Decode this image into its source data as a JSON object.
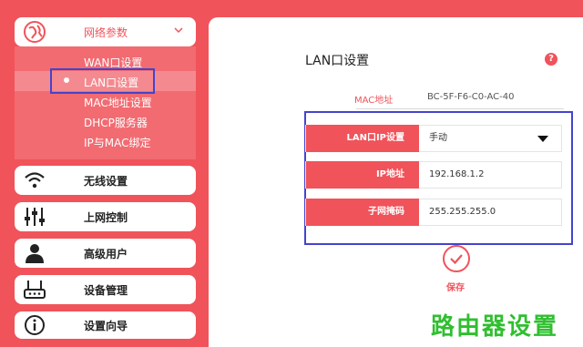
{
  "sidebar": {
    "network": {
      "label": "网络参数",
      "icon": "globe-icon"
    },
    "submenu": [
      {
        "label": "WAN口设置"
      },
      {
        "label": "LAN口设置",
        "selected": true
      },
      {
        "label": "MAC地址设置"
      },
      {
        "label": "DHCP服务器"
      },
      {
        "label": "IP与MAC绑定"
      }
    ],
    "items": [
      {
        "label": "无线设置",
        "icon": "wifi-icon"
      },
      {
        "label": "上网控制",
        "icon": "sliders-icon"
      },
      {
        "label": "高级用户",
        "icon": "user-icon"
      },
      {
        "label": "设备管理",
        "icon": "router-icon"
      },
      {
        "label": "设置向导",
        "icon": "info-icon"
      }
    ]
  },
  "main": {
    "title": "LAN口设置",
    "help": "?",
    "mac_label": "MAC地址",
    "mac_value": "BC-5F-F6-C0-AC-40",
    "fields": [
      {
        "label": "LAN口IP设置",
        "value": "手动"
      },
      {
        "label": "IP地址",
        "value": "192.168.1.2"
      },
      {
        "label": "子网掩码",
        "value": "255.255.255.0"
      }
    ],
    "save_label": "保存"
  },
  "watermark": "路由器设置",
  "colors": {
    "accent": "#f0535a",
    "select_outline": "#4444cc",
    "watermark": "#2fbf2f"
  }
}
